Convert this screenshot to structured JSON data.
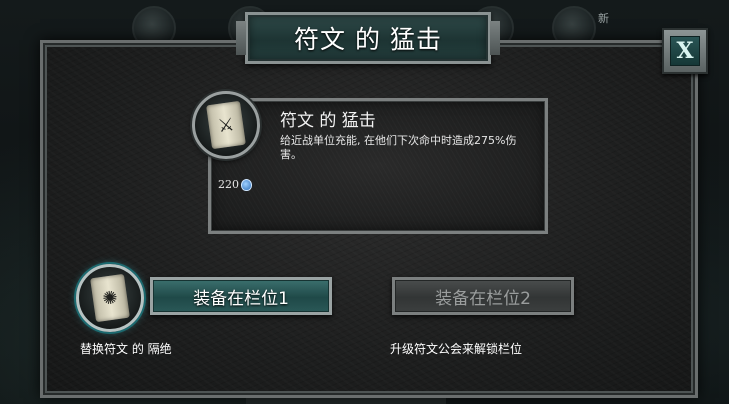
{
  "background": {
    "new_badge": "新"
  },
  "dialog": {
    "title": "符文 的 猛击",
    "close_label": "X"
  },
  "rune": {
    "name": "符文 的 猛击",
    "description": "给近战单位充能, 在他们下次命中时造成275%伤害。",
    "cost": "220",
    "icon": "scroll-rune-icon"
  },
  "slots": {
    "slot1_label": "装备在栏位1",
    "slot2_label": "装备在栏位2",
    "slot2_enabled": false,
    "current_icon": "scroll-rune-icon"
  },
  "captions": {
    "replace": "替换符文 的 隔绝",
    "unlock": "升级符文公会来解锁栏位"
  },
  "colors": {
    "accent_teal": "#1f4948",
    "disabled_gray": "#323535",
    "frame_silver": "#9aa3a3"
  }
}
